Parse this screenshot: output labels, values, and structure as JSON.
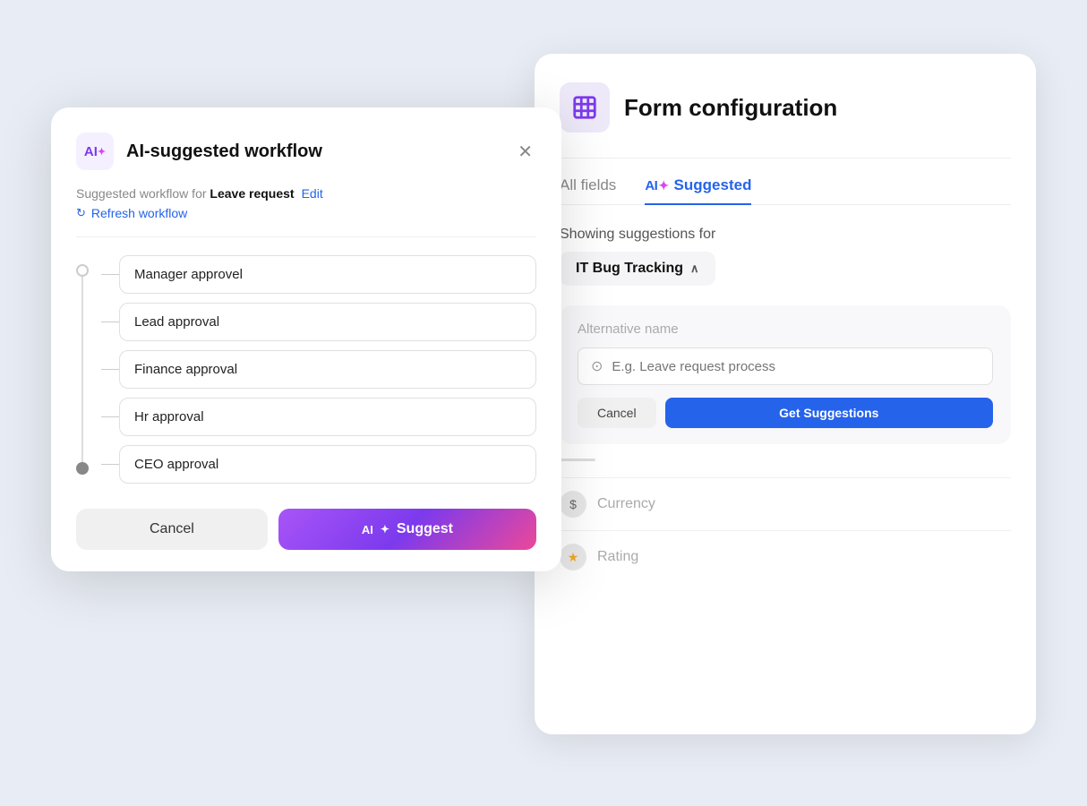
{
  "background_color": "#e8ecf4",
  "form_config": {
    "icon_alt": "form-config-icon",
    "title": "Form configuration",
    "tabs": [
      {
        "id": "all-fields",
        "label": "All fields",
        "active": false
      },
      {
        "id": "ai-suggested",
        "label": "Suggested",
        "active": true
      }
    ],
    "showing_label": "Showing suggestions for",
    "dropdown_label": "IT Bug Tracking",
    "suggestion_card": {
      "alt_name_label": "Alternative name",
      "input_placeholder": "E.g. Leave request process",
      "cancel_label": "Cancel",
      "get_suggestions_label": "Get Suggestions"
    },
    "fields": [
      {
        "id": "currency",
        "icon": "$",
        "label": "Currency"
      },
      {
        "id": "rating",
        "icon": "★",
        "label": "Rating"
      }
    ]
  },
  "ai_modal": {
    "icon_text": "AI",
    "title": "AI-suggested workflow",
    "close_icon": "✕",
    "subtitle_prefix": "Suggested workflow for",
    "subtitle_item": "Leave request",
    "edit_label": "Edit",
    "refresh_label": "Refresh workflow",
    "steps": [
      {
        "id": "step1",
        "label": "Manager approvel"
      },
      {
        "id": "step2",
        "label": "Lead approval"
      },
      {
        "id": "step3",
        "label": "Finance approval"
      },
      {
        "id": "step4",
        "label": "Hr approval"
      },
      {
        "id": "step5",
        "label": "CEO approval"
      }
    ],
    "cancel_label": "Cancel",
    "suggest_label": "Suggest",
    "suggest_prefix": "AI"
  }
}
